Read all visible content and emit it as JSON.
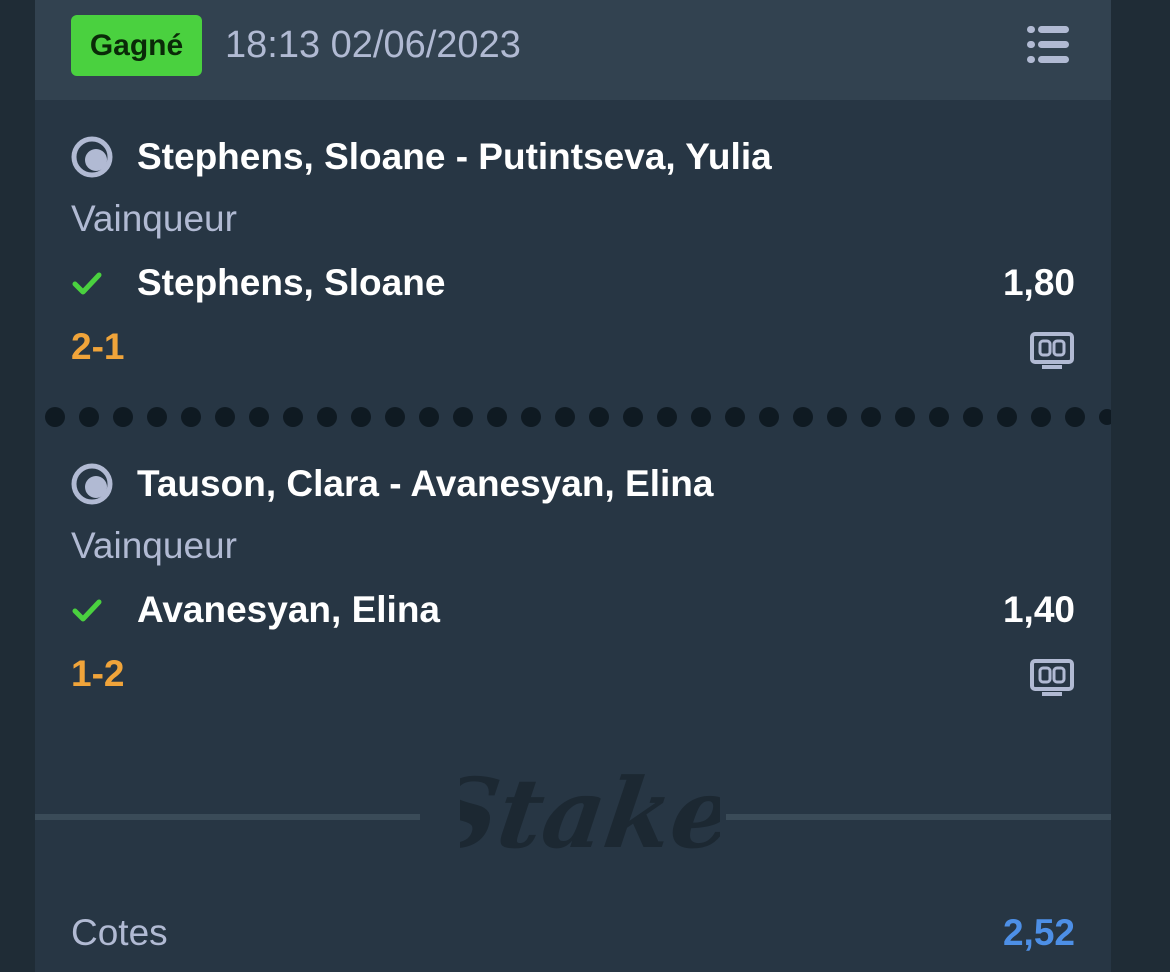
{
  "header": {
    "status_badge": "Gagné",
    "datetime": "18:13 02/06/2023",
    "menu_icon": "list-menu-icon",
    "colors": {
      "badge_bg": "#4ad13f",
      "header_bg": "#324250"
    }
  },
  "selections": [
    {
      "sport_icon": "tennis-ball-icon",
      "match": "Stephens, Sloane - Putintseva, Yulia",
      "market": "Vainqueur",
      "result_icon": "check-icon",
      "pick": "Stephens, Sloane",
      "odd": "1,80",
      "score": "2-1",
      "scoreboard_icon": "scoreboard-icon"
    },
    {
      "sport_icon": "tennis-ball-icon",
      "match": "Tauson, Clara - Avanesyan, Elina",
      "market": "Vainqueur",
      "result_icon": "check-icon",
      "pick": "Avanesyan, Elina",
      "odd": "1,40",
      "score": "1-2",
      "scoreboard_icon": "scoreboard-icon"
    }
  ],
  "watermark": {
    "logo_text": "Stake"
  },
  "footer": {
    "label": "Cotes",
    "value": "2,52",
    "colors": {
      "value": "#4d8fe6",
      "score": "#f0a43a",
      "check": "#4ad13f"
    }
  }
}
